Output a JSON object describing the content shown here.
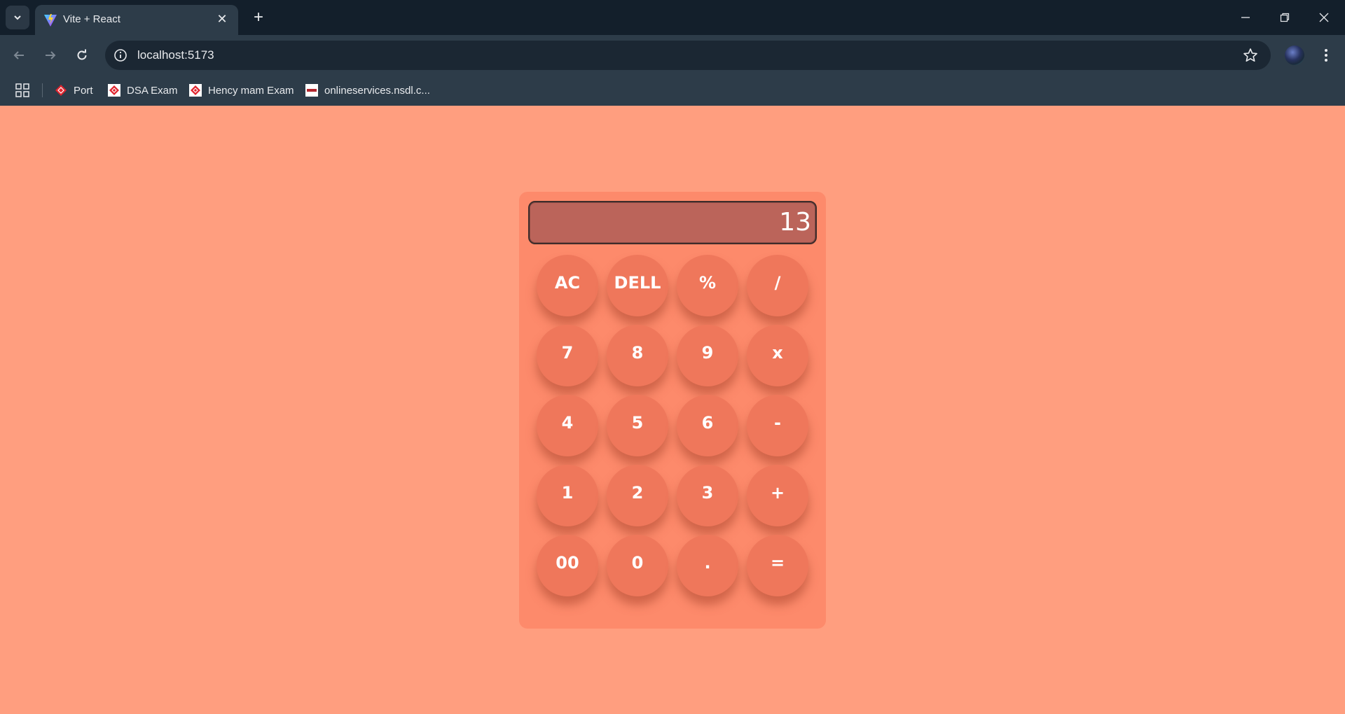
{
  "browser": {
    "tab_title": "Vite + React",
    "url": "localhost:5173",
    "bookmarks": [
      {
        "label": "Port"
      },
      {
        "label": "DSA Exam"
      },
      {
        "label": "Hency mam Exam"
      },
      {
        "label": "onlineservices.nsdl.c..."
      }
    ]
  },
  "calculator": {
    "display": "13",
    "keys": [
      [
        "AC",
        "DELL",
        "%",
        "/"
      ],
      [
        "7",
        "8",
        "9",
        "x"
      ],
      [
        "4",
        "5",
        "6",
        "-"
      ],
      [
        "1",
        "2",
        "3",
        "+"
      ],
      [
        "00",
        "0",
        ".",
        "="
      ]
    ]
  },
  "colors": {
    "page_bg": "#ff9e7f",
    "calc_bg": "#fd8a6b",
    "key_bg": "#ef775b",
    "display_bg": "#bb645a"
  }
}
